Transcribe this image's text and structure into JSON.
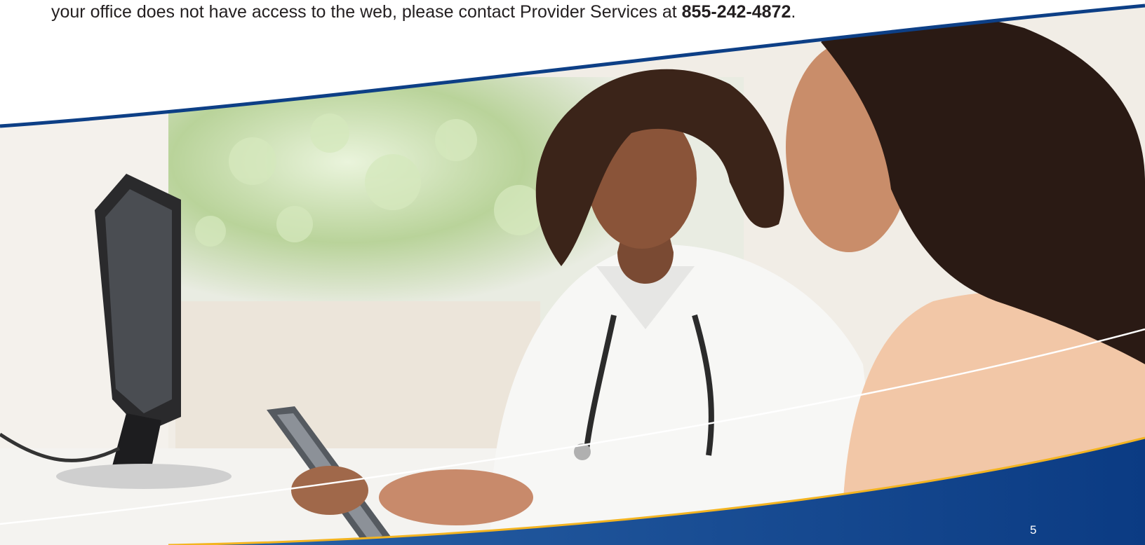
{
  "intro": {
    "text_before": "your office does not have access to the web, please contact Provider Services at ",
    "phone": "855-242-4872",
    "text_after": "."
  },
  "photo": {
    "subject": "doctor-and-patient-with-tablet"
  },
  "colors": {
    "navy_band": "#0d3f86",
    "gold_accent": "#f3b421",
    "text": "#231f20"
  },
  "footer": {
    "page_number": "5"
  }
}
